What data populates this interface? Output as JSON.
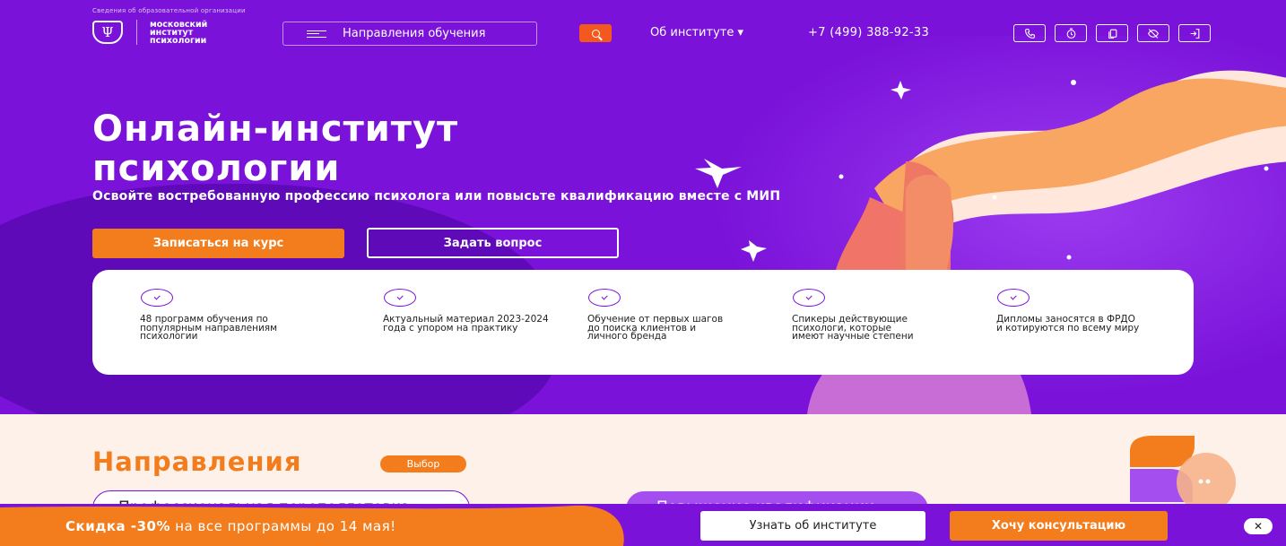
{
  "header": {
    "top_link": "Сведения об образовательной организации",
    "logo_text": "московский институт психологии",
    "logo_icon": "psi-icon",
    "directions_button": "Направления обучения",
    "search_icon": "search-icon",
    "about_menu": "Об институте ▾",
    "phone": "+7 (499) 388-92-33",
    "icon_buttons": [
      "phone-icon",
      "timer-icon",
      "copy-icon",
      "eye-off-icon",
      "login-icon"
    ]
  },
  "hero": {
    "title_line1": "Онлайн-институт",
    "title_line2": "психологии",
    "subtitle": "Освойте востребованную профессию психолога или повысьте квалификацию вместе с МИП",
    "enroll_button": "Записаться на курс",
    "ask_button": "Задать вопрос",
    "colors": {
      "background": "#7a12d9",
      "accent": "#f37d1c",
      "search": "#f3581f"
    }
  },
  "features": [
    "48 программ обучения по популярным направлениям психологии",
    "Актуальный материал 2023-2024 года с упором на практику",
    "Обучение от первых шагов до поиска клиентов и личного бренда",
    "Спикеры действующие психологи, которые имеют научные степени",
    "Дипломы заносятся в ФРДО и котируются по всему миру"
  ],
  "directions": {
    "title": "Направления",
    "badge": "Выбор",
    "tab_professional": "Профессиональная переподготовка",
    "tab_qualification": "Повышение квалификации"
  },
  "promo": {
    "discount": "Скидка -30%",
    "text": " на все программы до 14 мая!",
    "about_button": "Узнать об институте",
    "consult_button": "Хочу консультацию",
    "close": "✕"
  }
}
